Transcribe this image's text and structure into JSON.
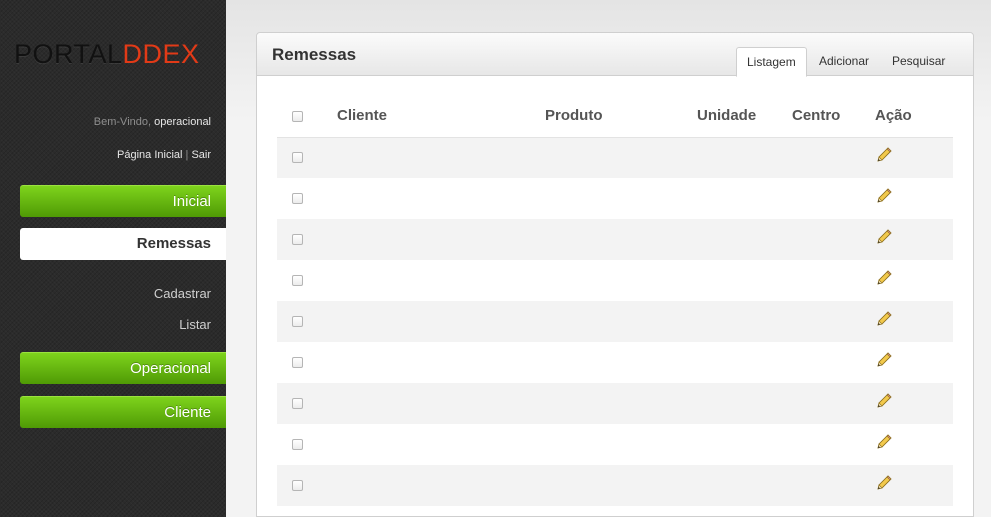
{
  "sidebar": {
    "logo_part1": "PORTAL",
    "logo_part2": "DDEX",
    "welcome_prefix": "Bem-Vindo,",
    "user_name": "operacional",
    "home_link": "Página Inicial",
    "separator": "|",
    "logout_link": "Sair",
    "nav": {
      "inicial": "Inicial",
      "remessas": "Remessas",
      "cadastrar": "Cadastrar",
      "listar": "Listar",
      "operacional": "Operacional",
      "cliente": "Cliente"
    }
  },
  "panel": {
    "title": "Remessas",
    "tabs": [
      "Listagem",
      "Adicionar",
      "Pesquisar"
    ],
    "active_tab": "Listagem"
  },
  "table": {
    "headers": [
      "Cliente",
      "Produto",
      "Unidade",
      "Centro",
      "Ação"
    ],
    "rows": [
      {
        "cliente": "",
        "produto": "",
        "unidade": "",
        "centro": ""
      },
      {
        "cliente": "",
        "produto": "",
        "unidade": "",
        "centro": ""
      },
      {
        "cliente": "",
        "produto": "",
        "unidade": "",
        "centro": ""
      },
      {
        "cliente": "",
        "produto": "",
        "unidade": "",
        "centro": ""
      },
      {
        "cliente": "",
        "produto": "",
        "unidade": "",
        "centro": ""
      },
      {
        "cliente": "",
        "produto": "",
        "unidade": "",
        "centro": ""
      },
      {
        "cliente": "",
        "produto": "",
        "unidade": "",
        "centro": ""
      },
      {
        "cliente": "",
        "produto": "",
        "unidade": "",
        "centro": ""
      },
      {
        "cliente": "",
        "produto": "",
        "unidade": "",
        "centro": ""
      }
    ],
    "action_icon": "pencil-edit-icon"
  },
  "colors": {
    "nav_green": "#5fae0e",
    "logo_accent": "#e23a17",
    "sidebar_bg": "#2b2b2b"
  }
}
